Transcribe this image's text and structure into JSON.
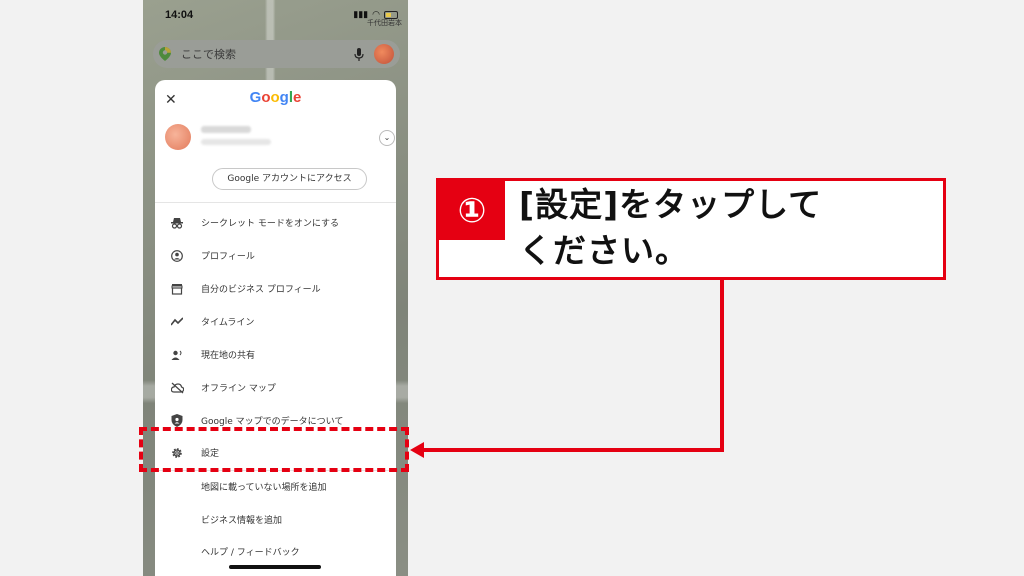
{
  "status_bar": {
    "time": "14:04",
    "map_label": "千代田岩本"
  },
  "search": {
    "placeholder": "ここで検索"
  },
  "menu": {
    "logo": [
      "G",
      "o",
      "o",
      "g",
      "l",
      "e"
    ],
    "account_button": "Google アカウントにアクセス",
    "items": [
      {
        "label": "シークレット モードをオンにする",
        "icon": "incognito-icon"
      },
      {
        "label": "プロフィール",
        "icon": "profile-icon"
      },
      {
        "label": "自分のビジネス プロフィール",
        "icon": "store-icon"
      },
      {
        "label": "タイムライン",
        "icon": "timeline-icon"
      },
      {
        "label": "現在地の共有",
        "icon": "location-share-icon"
      },
      {
        "label": "オフライン マップ",
        "icon": "cloud-off-icon"
      },
      {
        "label": "Google マップでのデータについて",
        "icon": "shield-icon"
      },
      {
        "label": "設定",
        "icon": "gear-icon"
      }
    ],
    "extra_items": [
      {
        "label": "地図に載っていない場所を追加"
      },
      {
        "label": "ビジネス情報を追加"
      },
      {
        "label": "ヘルプ / フィードバック"
      }
    ]
  },
  "callout": {
    "number": "①",
    "line1": "[設定]をタップして",
    "line2": "ください。"
  },
  "colors": {
    "accent": "#e50012",
    "g_blue": "#4285F4",
    "g_red": "#EA4335",
    "g_yellow": "#FBBC05",
    "g_green": "#34A853"
  }
}
